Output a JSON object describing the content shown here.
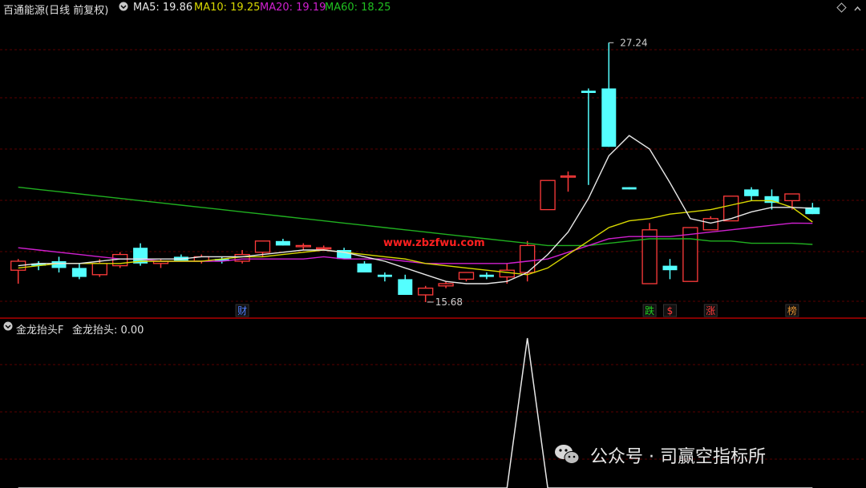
{
  "header": {
    "title": "百通能源(日线 前复权)",
    "ma_label": "MA5: 19.86",
    "ma10_label": "MA10: 19.25",
    "ma20_label": "MA20: 19.19",
    "ma60_label": "MA60: 18.25"
  },
  "indicator": {
    "name": "金龙抬头F",
    "value_label": "金龙抬头: 0.00"
  },
  "watermark_site": "www.zbzfwu.com",
  "watermark_account": "公众号 · 司赢空指标所",
  "colors": {
    "up": "#ff3b3b",
    "down": "#54ffff",
    "ma5": "#e8e8e8",
    "ma10": "#d8d800",
    "ma20": "#d020d0",
    "ma60": "#20b020",
    "grid": "#5a0000"
  },
  "chart_data": {
    "type": "candlestick",
    "title": "百通能源(日线 前复权)",
    "ylim": [
      15.0,
      28.0
    ],
    "annotations": [
      {
        "text": "27.24",
        "kind": "high",
        "index": 29
      },
      {
        "text": "15.68",
        "kind": "low",
        "index": 20
      }
    ],
    "event_markers": [
      {
        "text": "财",
        "index": 11,
        "color": "#4f7fff"
      },
      {
        "text": "跌",
        "index": 31,
        "color": "#20d020"
      },
      {
        "text": "$",
        "index": 32,
        "color": "#ff3b3b"
      },
      {
        "text": "涨",
        "index": 34,
        "color": "#ff3b3b"
      },
      {
        "text": "榜",
        "index": 38,
        "color": "#e09030"
      }
    ],
    "candles": [
      {
        "o": 17.1,
        "h": 17.6,
        "l": 16.5,
        "c": 17.5
      },
      {
        "o": 17.4,
        "h": 17.5,
        "l": 17.1,
        "c": 17.3
      },
      {
        "o": 17.5,
        "h": 17.7,
        "l": 17.0,
        "c": 17.2
      },
      {
        "o": 17.2,
        "h": 17.4,
        "l": 16.7,
        "c": 16.8
      },
      {
        "o": 16.9,
        "h": 17.6,
        "l": 16.8,
        "c": 17.4
      },
      {
        "o": 17.3,
        "h": 17.9,
        "l": 17.2,
        "c": 17.8
      },
      {
        "o": 18.1,
        "h": 18.3,
        "l": 17.3,
        "c": 17.4
      },
      {
        "o": 17.4,
        "h": 17.6,
        "l": 17.2,
        "c": 17.5
      },
      {
        "o": 17.7,
        "h": 17.8,
        "l": 17.5,
        "c": 17.5
      },
      {
        "o": 17.5,
        "h": 17.8,
        "l": 17.4,
        "c": 17.7
      },
      {
        "o": 17.6,
        "h": 17.7,
        "l": 17.4,
        "c": 17.5
      },
      {
        "o": 17.5,
        "h": 18.0,
        "l": 17.4,
        "c": 17.8
      },
      {
        "o": 17.9,
        "h": 18.4,
        "l": 17.7,
        "c": 18.4
      },
      {
        "o": 18.4,
        "h": 18.5,
        "l": 18.2,
        "c": 18.2
      },
      {
        "o": 18.2,
        "h": 18.3,
        "l": 18.0,
        "c": 18.2
      },
      {
        "o": 18.1,
        "h": 18.2,
        "l": 18.0,
        "c": 18.1
      },
      {
        "o": 18.0,
        "h": 18.1,
        "l": 17.6,
        "c": 17.6
      },
      {
        "o": 17.4,
        "h": 17.5,
        "l": 17.0,
        "c": 17.0
      },
      {
        "o": 16.9,
        "h": 17.0,
        "l": 16.6,
        "c": 16.8
      },
      {
        "o": 16.7,
        "h": 16.9,
        "l": 16.0,
        "c": 16.0
      },
      {
        "o": 16.0,
        "h": 16.4,
        "l": 15.68,
        "c": 16.3
      },
      {
        "o": 16.4,
        "h": 16.6,
        "l": 16.3,
        "c": 16.5
      },
      {
        "o": 16.7,
        "h": 17.0,
        "l": 16.6,
        "c": 17.0
      },
      {
        "o": 16.9,
        "h": 17.0,
        "l": 16.7,
        "c": 16.8
      },
      {
        "o": 16.8,
        "h": 17.4,
        "l": 16.5,
        "c": 17.1
      },
      {
        "o": 17.0,
        "h": 18.4,
        "l": 16.6,
        "c": 18.2
      },
      {
        "o": 19.8,
        "h": 21.1,
        "l": 19.8,
        "c": 21.1
      },
      {
        "o": 21.3,
        "h": 21.5,
        "l": 20.6,
        "c": 21.3
      },
      {
        "o": 25.1,
        "h": 25.2,
        "l": 20.9,
        "c": 25.0
      },
      {
        "o": 25.2,
        "h": 27.24,
        "l": 22.6,
        "c": 22.6
      },
      {
        "o": 20.8,
        "h": 20.8,
        "l": 20.7,
        "c": 20.7
      },
      {
        "o": 16.5,
        "h": 19.2,
        "l": 16.5,
        "c": 18.9
      },
      {
        "o": 17.3,
        "h": 17.6,
        "l": 16.7,
        "c": 17.1
      },
      {
        "o": 16.6,
        "h": 19.0,
        "l": 16.6,
        "c": 19.0
      },
      {
        "o": 18.9,
        "h": 19.5,
        "l": 18.9,
        "c": 19.4
      },
      {
        "o": 19.3,
        "h": 20.3,
        "l": 19.3,
        "c": 20.4
      },
      {
        "o": 20.7,
        "h": 20.8,
        "l": 20.2,
        "c": 20.4
      },
      {
        "o": 20.4,
        "h": 20.7,
        "l": 19.8,
        "c": 20.1
      },
      {
        "o": 20.2,
        "h": 20.5,
        "l": 19.8,
        "c": 20.5
      },
      {
        "o": 19.9,
        "h": 20.1,
        "l": 19.6,
        "c": 19.6
      }
    ],
    "ma5": [
      17.3,
      17.4,
      17.4,
      17.4,
      17.5,
      17.6,
      17.6,
      17.6,
      17.6,
      17.7,
      17.7,
      17.7,
      17.8,
      17.9,
      18.0,
      18.0,
      17.9,
      17.7,
      17.5,
      17.2,
      16.9,
      16.6,
      16.5,
      16.5,
      16.6,
      17.0,
      17.8,
      18.8,
      20.3,
      22.2,
      23.1,
      22.5,
      21.0,
      19.4,
      19.2,
      19.4,
      19.7,
      19.9,
      19.9,
      19.86
    ],
    "ma10": [
      17.2,
      17.3,
      17.4,
      17.4,
      17.4,
      17.4,
      17.5,
      17.5,
      17.5,
      17.5,
      17.6,
      17.7,
      17.7,
      17.8,
      17.9,
      18.0,
      17.9,
      17.8,
      17.7,
      17.6,
      17.4,
      17.3,
      17.2,
      17.1,
      17.0,
      16.9,
      17.2,
      17.8,
      18.4,
      19.0,
      19.3,
      19.4,
      19.6,
      19.7,
      19.8,
      20.0,
      20.2,
      20.2,
      19.9,
      19.25
    ],
    "ma20": [
      18.1,
      18.0,
      17.9,
      17.8,
      17.7,
      17.6,
      17.6,
      17.5,
      17.5,
      17.5,
      17.5,
      17.6,
      17.6,
      17.6,
      17.6,
      17.7,
      17.6,
      17.6,
      17.6,
      17.5,
      17.4,
      17.4,
      17.4,
      17.4,
      17.4,
      17.5,
      17.6,
      17.9,
      18.2,
      18.5,
      18.6,
      18.6,
      18.6,
      18.7,
      18.8,
      18.9,
      19.0,
      19.1,
      19.2,
      19.19
    ],
    "ma60": [
      20.8,
      20.7,
      20.6,
      20.5,
      20.4,
      20.3,
      20.2,
      20.1,
      20.0,
      19.9,
      19.8,
      19.7,
      19.6,
      19.5,
      19.4,
      19.3,
      19.2,
      19.1,
      19.0,
      18.9,
      18.8,
      18.7,
      18.6,
      18.5,
      18.4,
      18.3,
      18.2,
      18.2,
      18.2,
      18.3,
      18.4,
      18.5,
      18.5,
      18.5,
      18.4,
      18.4,
      18.3,
      18.3,
      18.3,
      18.25
    ],
    "indicator_values": [
      0,
      0,
      0,
      0,
      0,
      0,
      0,
      0,
      0,
      0,
      0,
      0,
      0,
      0,
      0,
      0,
      0,
      0,
      0,
      0,
      0,
      0,
      0,
      0,
      0,
      1,
      0,
      0,
      0,
      0,
      0,
      0,
      0,
      0,
      0,
      0,
      0,
      0,
      0,
      0
    ]
  }
}
